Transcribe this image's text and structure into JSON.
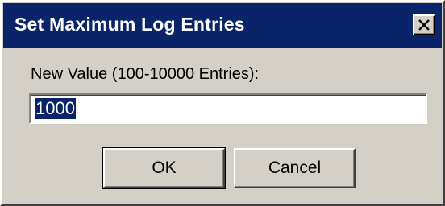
{
  "window": {
    "title": "Set Maximum Log Entries",
    "close_icon": "close-icon"
  },
  "form": {
    "prompt_label": "New Value (100-10000 Entries):",
    "value": "1000",
    "value_selected": true
  },
  "buttons": {
    "ok_label": "OK",
    "cancel_label": "Cancel"
  },
  "colors": {
    "titlebar": "#0a246a",
    "face": "#d4d0c8",
    "selection": "#0a246a"
  }
}
